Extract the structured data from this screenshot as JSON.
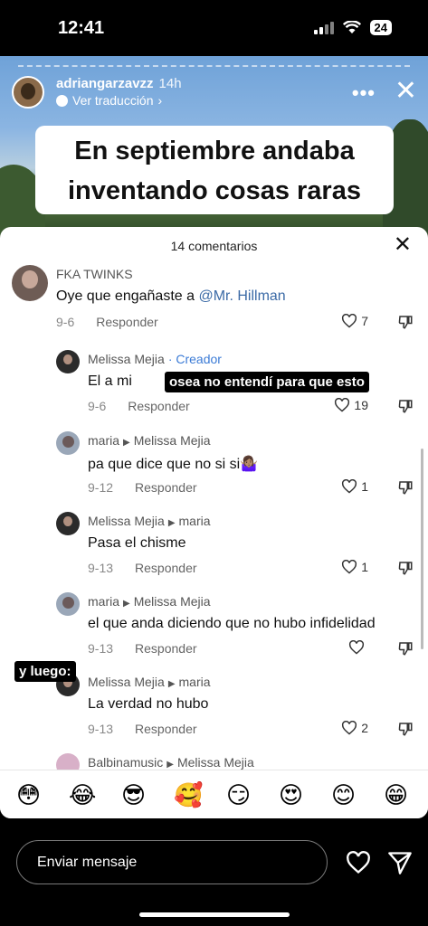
{
  "status_bar": {
    "time": "12:41",
    "battery": "24"
  },
  "story": {
    "username": "adriangarzavzz",
    "posted": "14h",
    "translate_label": "Ver traducción",
    "translate_chevron": "›",
    "caption_line1": "En septiembre andaba",
    "caption_line2": "inventando cosas raras"
  },
  "comments_sheet": {
    "title": "14 comentarios",
    "reply_label": "Responder",
    "comments": [
      {
        "user": "FKA TWINKS",
        "text_before": "Oye que engañaste a ",
        "mention": "@Mr. Hillman",
        "date": "9-6",
        "likes": "7"
      },
      {
        "user": "Melissa Mejia",
        "badge": "Creador",
        "text": "El a mi",
        "date": "9-6",
        "likes": "19"
      },
      {
        "user": "maria",
        "reply_to": "Melissa Mejia",
        "text": "pa que dice que no si si🤷🏽‍♀️",
        "date": "9-12",
        "likes": "1"
      },
      {
        "user": "Melissa Mejia",
        "reply_to": "maria",
        "text": "Pasa el chisme",
        "date": "9-13",
        "likes": "1"
      },
      {
        "user": "maria",
        "reply_to": "Melissa Mejia",
        "text": "el que anda diciendo que no hubo infidelidad",
        "date": "9-13",
        "likes": ""
      },
      {
        "user": "Melissa Mejia",
        "reply_to": "maria",
        "text": "La verdad no hubo",
        "date": "9-13",
        "likes": "2"
      },
      {
        "user": "Balbinamusic",
        "reply_to": "Melissa Mejia"
      }
    ],
    "stickers": {
      "sticker1": "osea no entendí para que esto",
      "sticker2": "y luego:"
    },
    "emojis": [
      "😳",
      "😂",
      "😎",
      "🥰",
      "😏",
      "😍",
      "😊",
      "😁"
    ]
  },
  "bottom_bar": {
    "message_placeholder": "Enviar mensaje"
  }
}
